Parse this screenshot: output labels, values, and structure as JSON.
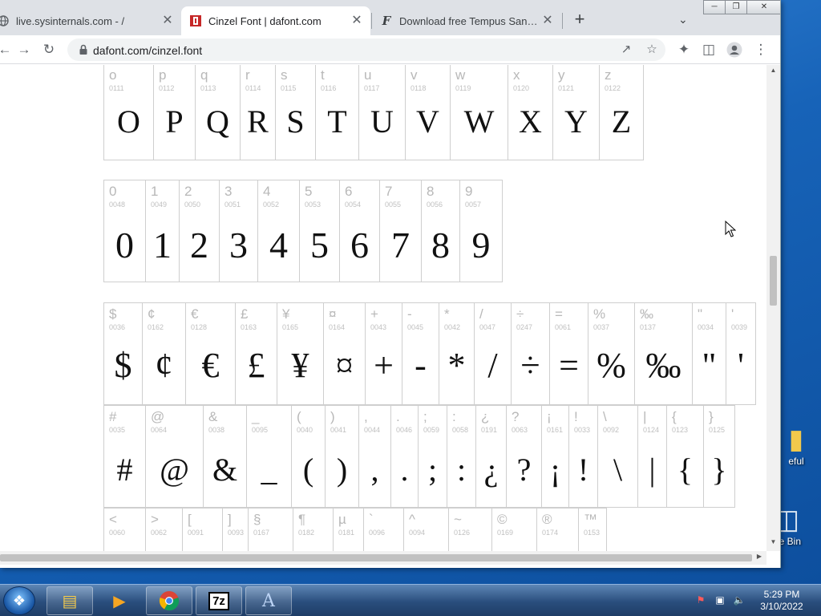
{
  "browser": {
    "tabs": [
      {
        "title": "live.sysinternals.com - /",
        "favicon": "globe-icon",
        "active": false
      },
      {
        "title": "Cinzel Font | dafont.com",
        "favicon": "dafont-icon",
        "active": true
      },
      {
        "title": "Download free Tempus Sans ITC",
        "favicon": "font-f-icon",
        "active": false
      }
    ],
    "new_tab_label": "+",
    "url": "dafont.com/cinzel.font"
  },
  "glyph_rows": [
    {
      "cells": [
        {
          "ch": "o",
          "code": "0111",
          "big": "O"
        },
        {
          "ch": "p",
          "code": "0112",
          "big": "P"
        },
        {
          "ch": "q",
          "code": "0113",
          "big": "Q"
        },
        {
          "ch": "r",
          "code": "0114",
          "big": "R"
        },
        {
          "ch": "s",
          "code": "0115",
          "big": "S"
        },
        {
          "ch": "t",
          "code": "0116",
          "big": "T"
        },
        {
          "ch": "u",
          "code": "0117",
          "big": "U"
        },
        {
          "ch": "v",
          "code": "0118",
          "big": "V"
        },
        {
          "ch": "w",
          "code": "0119",
          "big": "W"
        },
        {
          "ch": "x",
          "code": "0120",
          "big": "X"
        },
        {
          "ch": "y",
          "code": "0121",
          "big": "Y"
        },
        {
          "ch": "z",
          "code": "0122",
          "big": "Z"
        }
      ]
    },
    {
      "cells": [
        {
          "ch": "0",
          "code": "0048",
          "big": "0"
        },
        {
          "ch": "1",
          "code": "0049",
          "big": "1"
        },
        {
          "ch": "2",
          "code": "0050",
          "big": "2"
        },
        {
          "ch": "3",
          "code": "0051",
          "big": "3"
        },
        {
          "ch": "4",
          "code": "0052",
          "big": "4"
        },
        {
          "ch": "5",
          "code": "0053",
          "big": "5"
        },
        {
          "ch": "6",
          "code": "0054",
          "big": "6"
        },
        {
          "ch": "7",
          "code": "0055",
          "big": "7"
        },
        {
          "ch": "8",
          "code": "0056",
          "big": "8"
        },
        {
          "ch": "9",
          "code": "0057",
          "big": "9"
        }
      ]
    },
    {
      "cells": [
        {
          "ch": "$",
          "code": "0036",
          "big": "$"
        },
        {
          "ch": "¢",
          "code": "0162",
          "big": "¢"
        },
        {
          "ch": "€",
          "code": "0128",
          "big": "€"
        },
        {
          "ch": "£",
          "code": "0163",
          "big": "£"
        },
        {
          "ch": "¥",
          "code": "0165",
          "big": "¥"
        },
        {
          "ch": "¤",
          "code": "0164",
          "big": "¤"
        },
        {
          "ch": "+",
          "code": "0043",
          "big": "+"
        },
        {
          "ch": "-",
          "code": "0045",
          "big": "-"
        },
        {
          "ch": "*",
          "code": "0042",
          "big": "*"
        },
        {
          "ch": "/",
          "code": "0047",
          "big": "/"
        },
        {
          "ch": "÷",
          "code": "0247",
          "big": "÷"
        },
        {
          "ch": "=",
          "code": "0061",
          "big": "="
        },
        {
          "ch": "%",
          "code": "0037",
          "big": "%"
        },
        {
          "ch": "‰",
          "code": "0137",
          "big": "‰"
        },
        {
          "ch": "\"",
          "code": "0034",
          "big": "\""
        },
        {
          "ch": "'",
          "code": "0039",
          "big": "'"
        }
      ]
    },
    {
      "cells": [
        {
          "ch": "#",
          "code": "0035",
          "big": "#"
        },
        {
          "ch": "@",
          "code": "0064",
          "big": "@"
        },
        {
          "ch": "&",
          "code": "0038",
          "big": "&"
        },
        {
          "ch": "_",
          "code": "0095",
          "big": "_"
        },
        {
          "ch": "(",
          "code": "0040",
          "big": "("
        },
        {
          "ch": ")",
          "code": "0041",
          "big": ")"
        },
        {
          "ch": ",",
          "code": "0044",
          "big": ","
        },
        {
          "ch": ".",
          "code": "0046",
          "big": "."
        },
        {
          "ch": ";",
          "code": "0059",
          "big": ";"
        },
        {
          "ch": ":",
          "code": "0058",
          "big": ":"
        },
        {
          "ch": "¿",
          "code": "0191",
          "big": "¿"
        },
        {
          "ch": "?",
          "code": "0063",
          "big": "?"
        },
        {
          "ch": "¡",
          "code": "0161",
          "big": "¡"
        },
        {
          "ch": "!",
          "code": "0033",
          "big": "!"
        },
        {
          "ch": "\\",
          "code": "0092",
          "big": "\\"
        },
        {
          "ch": "|",
          "code": "0124",
          "big": "|"
        },
        {
          "ch": "{",
          "code": "0123",
          "big": "{"
        },
        {
          "ch": "}",
          "code": "0125",
          "big": "}"
        }
      ]
    },
    {
      "cells": [
        {
          "ch": "<",
          "code": "0060",
          "big": ""
        },
        {
          "ch": ">",
          "code": "0062",
          "big": ""
        },
        {
          "ch": "[",
          "code": "0091",
          "big": ""
        },
        {
          "ch": "]",
          "code": "0093",
          "big": ""
        },
        {
          "ch": "§",
          "code": "0167",
          "big": ""
        },
        {
          "ch": "¶",
          "code": "0182",
          "big": ""
        },
        {
          "ch": "µ",
          "code": "0181",
          "big": ""
        },
        {
          "ch": "`",
          "code": "0096",
          "big": ""
        },
        {
          "ch": "^",
          "code": "0094",
          "big": ""
        },
        {
          "ch": "~",
          "code": "0126",
          "big": ""
        },
        {
          "ch": "©",
          "code": "0169",
          "big": ""
        },
        {
          "ch": "®",
          "code": "0174",
          "big": ""
        },
        {
          "ch": "™",
          "code": "0153",
          "big": ""
        }
      ]
    }
  ],
  "desktop_icons": [
    {
      "label": "eful",
      "icon": "folder-icon"
    },
    {
      "label": "cle Bin",
      "icon": "recycle-bin-icon"
    }
  ],
  "taskbar": {
    "apps": [
      "explorer-icon",
      "media-player-icon",
      "chrome-icon",
      "7zip-icon",
      "font-app-icon"
    ],
    "time": "5:29 PM",
    "date": "3/10/2022"
  }
}
